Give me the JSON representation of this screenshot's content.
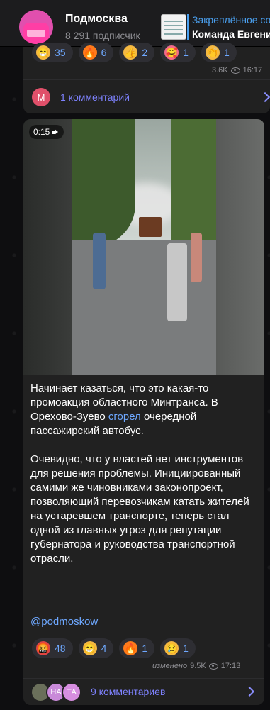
{
  "header": {
    "channel_name": "Подмосква",
    "subscribers": "8 291 подписчик",
    "pinned_title": "Закреплённое со",
    "pinned_text": "Команда Евгени"
  },
  "top_message": {
    "reactions": [
      {
        "emoji": "😁",
        "count": "35",
        "color": "#f5b942"
      },
      {
        "emoji": "🔥",
        "count": "6",
        "color": "#ff7a1a"
      },
      {
        "emoji": "👍",
        "count": "2",
        "color": "#f5b942"
      },
      {
        "emoji": "🥰",
        "count": "1",
        "color": "#f36a8c"
      },
      {
        "emoji": "👏",
        "count": "1",
        "color": "#f5b942"
      }
    ],
    "views": "3.6K",
    "time": "16:17",
    "comment_avatar_letter": "М",
    "comment_label": "1 комментарий"
  },
  "post": {
    "video_time": "0:15",
    "paragraph_1_before_link": "Начинает казаться, что это какая-то промоакция областного Минтранса. В Орехово-Зуево ",
    "paragraph_1_link": "сгорел",
    "paragraph_1_after_link": " очередной пассажирский автобус.",
    "paragraph_2": "Очевидно, что у властей нет инструментов для решения проблемы. Инициированный самими же чиновниками законопроект, позволяющий перевозчикам катать жителей на устаревшем транспорте, теперь стал одной из главных угроз для репутации губернатора и руководства транспортной отрасли.",
    "signature": "@podmoskow",
    "reactions": [
      {
        "emoji": "🤬",
        "count": "48",
        "color": "#e04444"
      },
      {
        "emoji": "😁",
        "count": "4",
        "color": "#f5b942"
      },
      {
        "emoji": "🔥",
        "count": "1",
        "color": "#ff7a1a"
      },
      {
        "emoji": "😢",
        "count": "1",
        "color": "#f5b942"
      }
    ],
    "edited_label": "изменено",
    "views": "9.5K",
    "time": "17:13",
    "comment_avatars": [
      "",
      "НА",
      "ТА"
    ],
    "comments_label": "9 комментариев"
  }
}
